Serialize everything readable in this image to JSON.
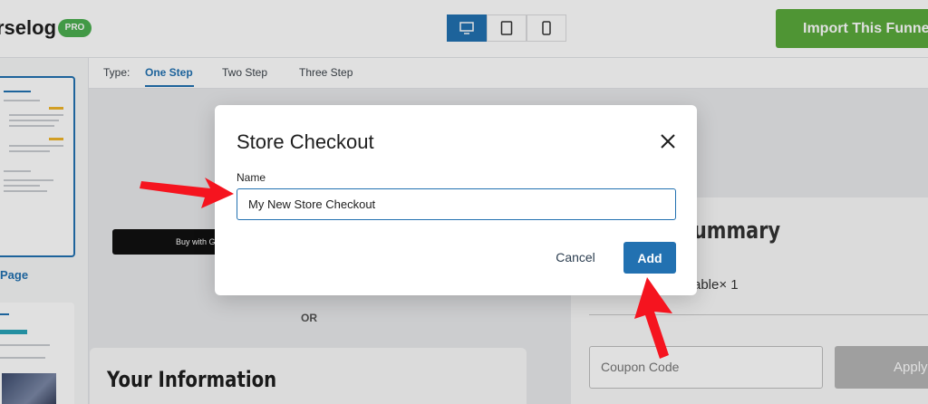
{
  "header": {
    "brand": "rselog",
    "pro_badge": "PRO",
    "device_buttons": [
      "desktop-icon",
      "tablet-icon",
      "mobile-icon"
    ],
    "import_label": "Import This Funnel"
  },
  "sidebar": {
    "thumb_label": "Page"
  },
  "type_bar": {
    "label": "Type:",
    "tabs": [
      "One Step",
      "Two Step",
      "Three Step"
    ],
    "active_tab": "One Step"
  },
  "canvas": {
    "buy_button": "Buy with G",
    "or_text": "OR",
    "info_title": "Your Information"
  },
  "summary": {
    "title": "ummary",
    "qty_text": "able× 1",
    "coupon_placeholder": "Coupon Code",
    "apply_label": "Apply"
  },
  "modal": {
    "title": "Store Checkout",
    "name_label": "Name",
    "name_value": "My New Store Checkout",
    "cancel_label": "Cancel",
    "add_label": "Add"
  },
  "colors": {
    "accent": "#2271b1",
    "import_green": "#5aaa3c",
    "arrow_red": "#f5141f"
  }
}
